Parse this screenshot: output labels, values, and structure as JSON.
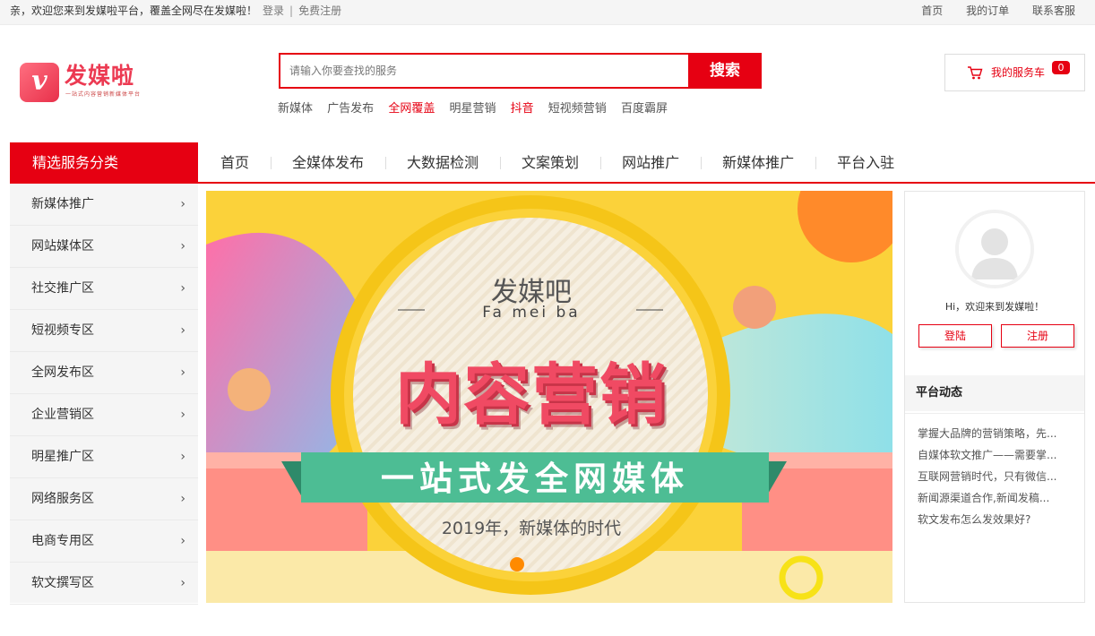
{
  "topbar": {
    "welcome": "亲，欢迎您来到发媒啦平台，覆盖全网尽在发媒啦！",
    "login": "登录",
    "separator": "|",
    "register": "免费注册",
    "links": [
      "首页",
      "我的订单",
      "联系客服"
    ]
  },
  "logo": {
    "badge": "v",
    "name": "发媒啦",
    "slogan": "一站式内容营销新媒体平台"
  },
  "search": {
    "placeholder": "请输入你要查找的服务",
    "button": "搜索",
    "hotwords": [
      {
        "label": "新媒体",
        "hot": false
      },
      {
        "label": "广告发布",
        "hot": false
      },
      {
        "label": "全网覆盖",
        "hot": true
      },
      {
        "label": "明星营销",
        "hot": false
      },
      {
        "label": "抖音",
        "hot": true
      },
      {
        "label": "短视频营销",
        "hot": false
      },
      {
        "label": "百度霸屏",
        "hot": false
      }
    ]
  },
  "cart": {
    "label": "我的服务车",
    "count": "0",
    "icon": "cart-icon"
  },
  "nav": {
    "category_title": "精选服务分类",
    "items": [
      "首页",
      "全媒体发布",
      "大数据检测",
      "文案策划",
      "网站推广",
      "新媒体推广",
      "平台入驻"
    ]
  },
  "sidebar": {
    "arrow": "›",
    "items": [
      "新媒体推广",
      "网站媒体区",
      "社交推广区",
      "短视频专区",
      "全网发布区",
      "企业营销区",
      "明星推广区",
      "网络服务区",
      "电商专用区",
      "软文撰写区"
    ]
  },
  "banner": {
    "title": "发媒吧",
    "subtitle": "Fa mei ba",
    "headline": "内容营销",
    "ribbon": "一站式发全网媒体",
    "tagline": "2019年，新媒体的时代"
  },
  "user_panel": {
    "greeting": "Hi，欢迎来到发媒啦！",
    "login_button": "登陆",
    "register_button": "注册",
    "news_title": "平台动态",
    "news": [
      "掌握大品牌的营销策略，先...",
      "自媒体软文推广——需要掌...",
      "互联网营销时代，只有微信...",
      "新闻源渠道合作,新闻发稿...",
      "软文发布怎么发效果好?"
    ]
  },
  "colors": {
    "brand_red": "#e60012",
    "logo_pink": "#ec3a52",
    "banner_yellow": "#fbd23a",
    "ribbon_green": "#4dbd94"
  }
}
